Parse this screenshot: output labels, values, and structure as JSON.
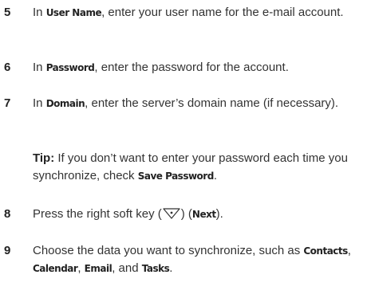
{
  "steps": [
    {
      "number": "5",
      "pre": "In ",
      "field": "User Name",
      "post": ", enter your user name for the e-mail account."
    },
    {
      "number": "6",
      "pre": "In ",
      "field": "Password",
      "post": ", enter the password for the account."
    },
    {
      "number": "7",
      "pre": "In ",
      "field": "Domain",
      "post": ", enter the server’s domain name (if necessary)."
    },
    {
      "number": "8",
      "pre": "Press the right soft key (",
      "icon": "right-soft-key-icon",
      "mid": ") (",
      "field": "Next",
      "post": ")."
    },
    {
      "number": "9",
      "pre": "Choose the data you want to synchronize, such as ",
      "items": [
        "Contacts",
        "Calendar",
        "Email",
        "Tasks"
      ],
      "sep1": ", ",
      "sep2": ", ",
      "sep3": ", and ",
      "post": "."
    }
  ],
  "tip": {
    "label": "Tip:",
    "text": " If you don’t want to enter your password each time you synchronize, check ",
    "field": "Save Password",
    "post": "."
  }
}
